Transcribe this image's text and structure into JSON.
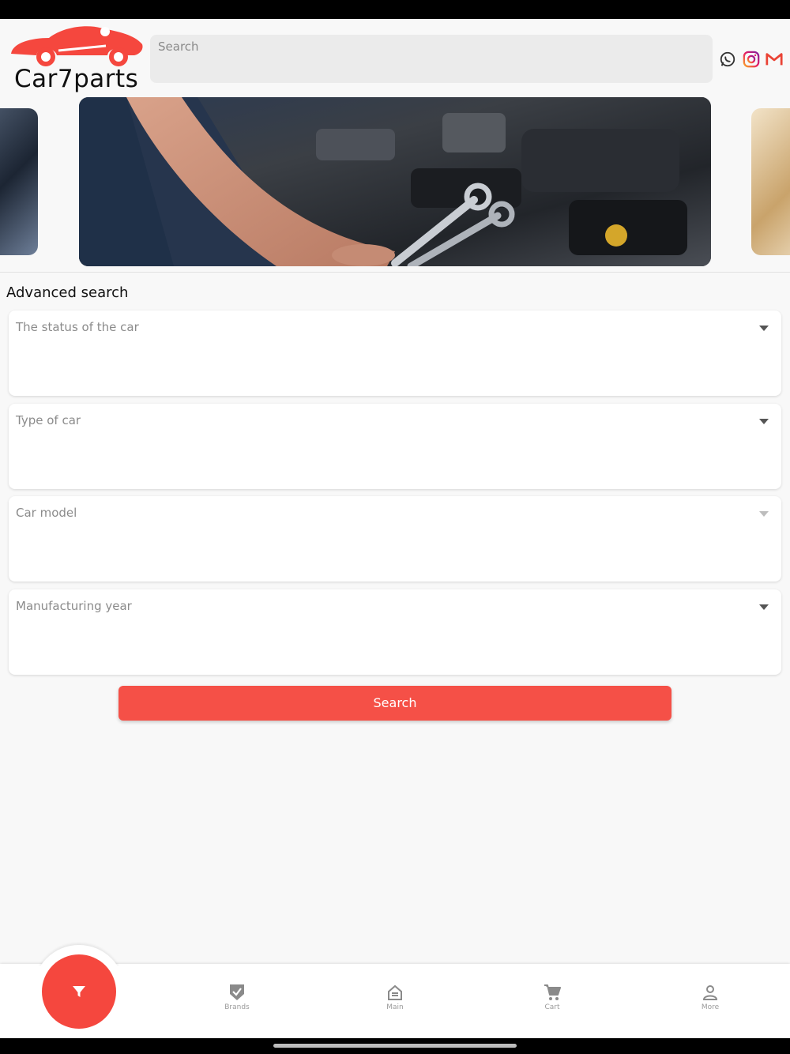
{
  "app": {
    "logo_text": "Car7parts",
    "brand_color": "#f5473e"
  },
  "header": {
    "search_placeholder": "Search",
    "social_icons": [
      "whatsapp-icon",
      "instagram-icon",
      "gmail-icon"
    ]
  },
  "advanced_search": {
    "title": "Advanced search",
    "fields": [
      {
        "placeholder": "The status of the car",
        "enabled": true
      },
      {
        "placeholder": "Type of car",
        "enabled": true
      },
      {
        "placeholder": "Car model",
        "enabled": false
      },
      {
        "placeholder": "Manufacturing year",
        "enabled": true
      }
    ],
    "submit_label": "Search"
  },
  "bottom_nav": {
    "fab_icon": "filter-icon",
    "items": [
      {
        "label": "Brands",
        "icon": "shield-check-icon"
      },
      {
        "label": "Main",
        "icon": "home-icon"
      },
      {
        "label": "Cart",
        "icon": "cart-icon"
      },
      {
        "label": "More",
        "icon": "person-icon"
      }
    ]
  }
}
